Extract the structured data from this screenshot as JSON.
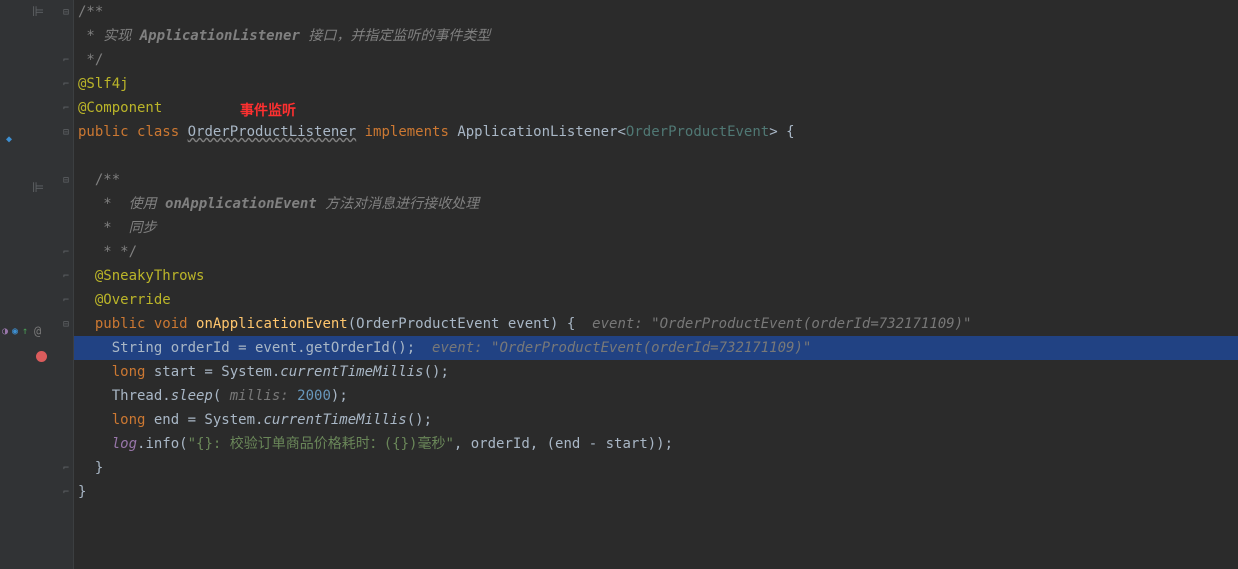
{
  "redLabel": "事件监听",
  "lines": {
    "l1_a": "/**",
    "l2_a": " * ",
    "l2_b": "实现 ",
    "l2_c": "ApplicationListener",
    "l2_d": " 接口，并指定监听的事件类型",
    "l3_a": " */",
    "l4_a": "@Slf4j",
    "l5_a": "@Component",
    "l6_a": "public ",
    "l6_b": "class ",
    "l6_c": "OrderProductListener",
    "l6_d": " implements ",
    "l6_e": "ApplicationListener",
    "l6_f": "<",
    "l6_g": "OrderProductEvent",
    "l6_h": "> {",
    "l8_a": "  /**",
    "l9_a": "   *  ",
    "l9_b": "使用 ",
    "l9_c": "onApplicationEvent",
    "l9_d": " 方法对消息进行接收处理",
    "l10_a": "   *  ",
    "l10_b": "同步",
    "l11_a": "   * */",
    "l12_a": "  @SneakyThrows",
    "l13_a": "  @Override",
    "l14_a": "  public ",
    "l14_b": "void ",
    "l14_c": "onApplicationEvent",
    "l14_d": "(OrderProductEvent event) {  ",
    "l14_e": "event: \"OrderProductEvent(orderId=732171109)\"",
    "l15_a": "    String orderId = event.getOrderId();  ",
    "l15_b": "event: \"OrderProductEvent(orderId=732171109)\"",
    "l16_a": "    long ",
    "l16_b": "start = System.",
    "l16_c": "currentTimeMillis",
    "l16_d": "();",
    "l17_a": "    Thread.",
    "l17_b": "sleep",
    "l17_c": "( ",
    "l17_d": "millis: ",
    "l17_e": "2000",
    "l17_f": ");",
    "l18_a": "    long ",
    "l18_b": "end = System.",
    "l18_c": "currentTimeMillis",
    "l18_d": "();",
    "l19_a": "    ",
    "l19_b": "log",
    "l19_c": ".info(",
    "l19_d": "\"{}: 校验订单商品价格耗时：({})毫秒\"",
    "l19_e": ", orderId, (end - start));",
    "l20_a": "  }",
    "l21_a": "}"
  }
}
